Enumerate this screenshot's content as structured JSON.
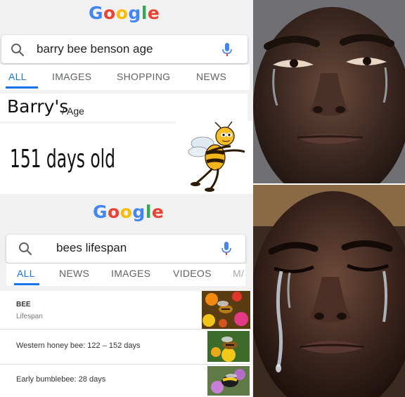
{
  "top": {
    "logo": [
      "G",
      "o",
      "o",
      "g",
      "l",
      "e"
    ],
    "logo_colors": [
      "#4285F4",
      "#EA4335",
      "#FBBC05",
      "#4285F4",
      "#34A853",
      "#EA4335"
    ],
    "query": "barry bee benson age",
    "tabs": [
      "ALL",
      "IMAGES",
      "SHOPPING",
      "NEWS"
    ],
    "answer_title": "Barry's",
    "answer_sub": "/ Age",
    "answer_value": "151 days old"
  },
  "bottom": {
    "logo": [
      "G",
      "o",
      "o",
      "g",
      "l",
      "e"
    ],
    "query": "bees lifespan",
    "tabs": [
      "ALL",
      "NEWS",
      "IMAGES",
      "VIDEOS",
      "M/"
    ],
    "results": [
      {
        "title": "BEE",
        "subtitle": "Lifespan"
      },
      {
        "text": "Western honey bee: 122 – 152 days"
      },
      {
        "text": "Early bumblebee: 28 days"
      }
    ]
  },
  "colors": {
    "accent": "#1a73e8",
    "mic_blue": "#4285F4",
    "mic_red": "#EA4335"
  }
}
